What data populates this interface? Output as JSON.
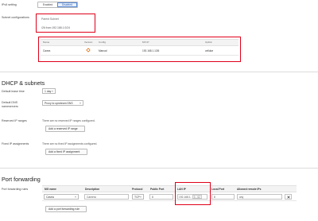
{
  "ipv6": {
    "label": "IPv6 setting",
    "enabled": "Enabled",
    "disabled": "Disabled"
  },
  "subnet_config": {
    "label": "Subnet configurations",
    "parent_subnet_label": "Parent Subnet",
    "parent_subnet_value": "/26 from 192.168.1.0/24",
    "table": {
      "headers": {
        "name": "Name",
        "vlan": "Version",
        "config": "Config",
        "mx_ip": "MX IP",
        "uplink": "Uplink"
      },
      "row": {
        "name": "Cavea",
        "config": "Manual",
        "mx_ip": "192.168.1.1/26",
        "uplink": "cellular"
      }
    }
  },
  "dhcp": {
    "title": "DHCP & subnets",
    "lease_label": "Default lease time",
    "lease_value": "1 day",
    "dns_label": "Default DNS nameservers",
    "dns_value": "Proxy to upstream DNS",
    "reserved_label": "Reserved IP ranges",
    "reserved_text": "There are no reserved IP ranges configured.",
    "reserved_button": "Add a reserved IP range",
    "fixed_label": "Fixed IP assignments",
    "fixed_text": "There are no fixed IP assignments configured.",
    "fixed_button": "Add a fixed IP assignment"
  },
  "port_forwarding": {
    "title": "Port forwarding",
    "rules_label": "Port forwarding rules",
    "headers": {
      "mg_name": "MG name",
      "description": "Description",
      "protocol": "Protocol",
      "public_port": "Public Port",
      "lan_ip": "LAN IP",
      "local_port": "Local Port",
      "allowed_ips": "Allowed remote IPs"
    },
    "row": {
      "mg_name": "Cavea",
      "description": "Camera",
      "protocol": "TCP",
      "public_port": "8",
      "lan_ip_prefix": "192.168.1.",
      "lan_ip_suffix": "5 - 62",
      "local_port": "8",
      "allowed_ips": "any"
    },
    "add_button": "Add a port forwarding rule"
  },
  "colors": {
    "highlight": "#e0001a",
    "selected": "#2b5fb0",
    "vpn_icon": "#e8731a"
  },
  "icons": {
    "vpn": "vpn-status-icon",
    "delete": "close-icon",
    "dropdown": "chevron-down-icon"
  }
}
